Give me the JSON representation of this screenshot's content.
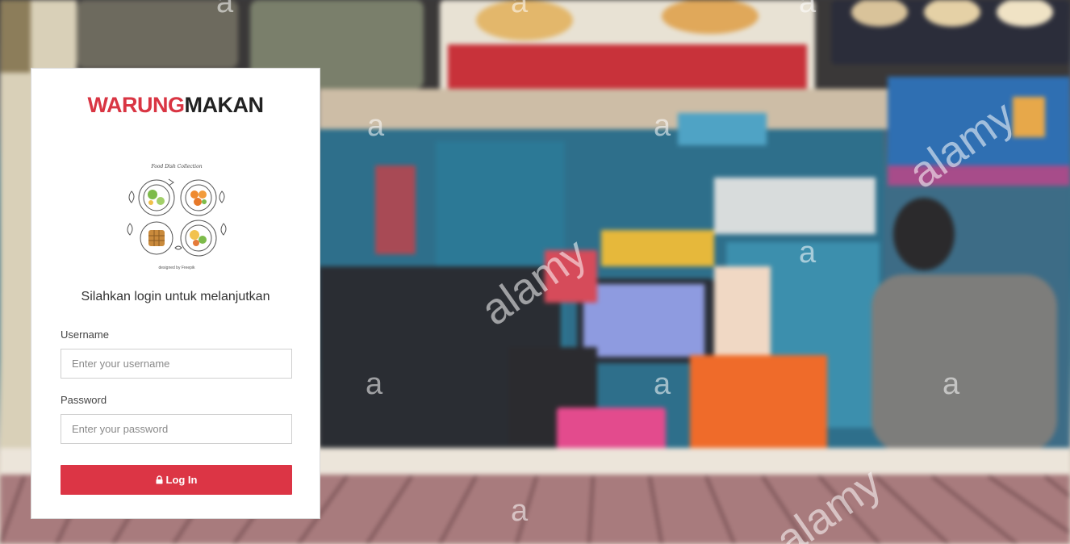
{
  "brand": {
    "part1": "WARUNG",
    "part2": "MAKAN"
  },
  "logo": {
    "caption": "Food Dish Collection",
    "credit": "designed by Freepik"
  },
  "subtitle": "Silahkan login untuk melanjutkan",
  "form": {
    "username_label": "Username",
    "username_placeholder": "Enter your username",
    "password_label": "Password",
    "password_placeholder": "Enter your password",
    "submit_label": "Log In",
    "submit_icon": "lock-icon"
  },
  "watermark": {
    "letter": "a",
    "word": "alamy"
  },
  "colors": {
    "accent": "#dc3545",
    "brand_red": "#d93543",
    "brand_dark": "#222222"
  }
}
